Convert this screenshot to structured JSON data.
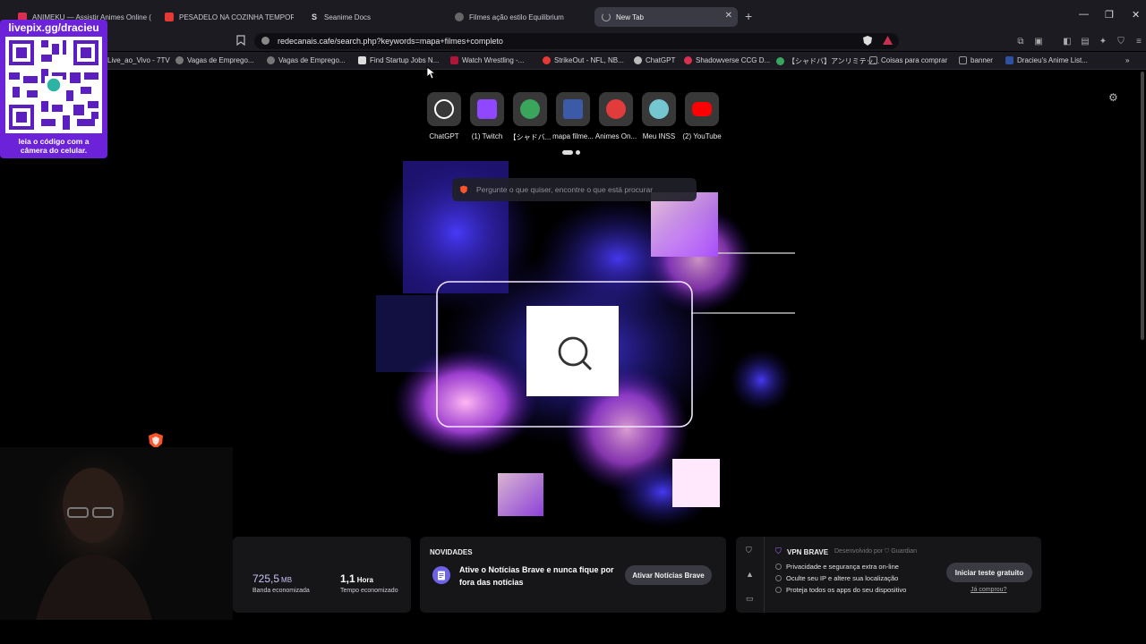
{
  "tabs": [
    {
      "title": "ANIMEKU — Assistir Animes Online (",
      "color": "#d9304f"
    },
    {
      "title": "PESADELO NA COZINHA TEMPORAD",
      "color": "#e53935"
    },
    {
      "title": "Seanime Docs",
      "color": "#222"
    },
    {
      "title": "Filmes ação estilo Equilibrium",
      "color": "#999"
    },
    {
      "title": "New Tab",
      "color": "#888"
    }
  ],
  "address": {
    "url": "redecanais.cafe/search.php?keywords=mapa+filmes+completo"
  },
  "bookmarks": [
    {
      "label": "Live_ao_Vivo - 7TV",
      "color": "#555"
    },
    {
      "label": "Vagas de Emprego...",
      "color": "#777"
    },
    {
      "label": "Vagas de Emprego...",
      "color": "#777"
    },
    {
      "label": "Find Startup Jobs N...",
      "color": "#ddd"
    },
    {
      "label": "Watch Wrestling -...",
      "color": "#b0163a"
    },
    {
      "label": "StrikeOut - NFL, NB...",
      "color": "#e53935"
    },
    {
      "label": "ChatGPT",
      "color": "#bbb"
    },
    {
      "label": "Shadowverse CCG D...",
      "color": "#d9304f"
    },
    {
      "label": "【シャドバ】アンリミテッ...",
      "color": "#3aa55c"
    },
    {
      "label": "Coisas para comprar",
      "color": "#999"
    },
    {
      "label": "banner",
      "color": "#999"
    },
    {
      "label": "Dracieu's Anime List...",
      "color": "#2e51a2"
    }
  ],
  "qr": {
    "title": "livepix.gg/dracieu",
    "caption_line1": "leia o código com a",
    "caption_line2": "câmera do celular."
  },
  "top_sites": [
    {
      "label": "ChatGPT",
      "color": "#ffffff"
    },
    {
      "label": "(1) Twitch",
      "color": "#9146ff"
    },
    {
      "label": "【シャドバ...",
      "color": "#3aa55c"
    },
    {
      "label": "mapa filme...",
      "color": "#3b5ba9"
    },
    {
      "label": "Animes On...",
      "color": "#e23b3b"
    },
    {
      "label": "Meu INSS",
      "color": "#74c7d1"
    },
    {
      "label": "(2) YouTube",
      "color": "#ff0000"
    }
  ],
  "search": {
    "placeholder": "Pergunte o que quiser, encontre o que está procurar"
  },
  "stats": {
    "bandwidth_value": "725,5",
    "bandwidth_unit": "MB",
    "bandwidth_label": "Banda economizada",
    "time_value": "1,1",
    "time_unit": "Hora",
    "time_label": "Tempo economizado"
  },
  "news": {
    "heading": "NOVIDADES",
    "text": "Ative o Notícias Brave e nunca fique por fora das notícias",
    "button": "Ativar Notícias Brave"
  },
  "vpn": {
    "title": "VPN BRAVE",
    "subtitle": "Desenvolvido por",
    "provider": "Guardian",
    "items": [
      "Privacidade e segurança extra on-line",
      "Oculte seu IP e altere sua localização",
      "Proteja todos os apps do seu dispositivo"
    ],
    "button": "Iniciar teste gratuito",
    "link": "Já comprou?"
  },
  "colors": {
    "brave_orange": "#fb542b",
    "accent_purple": "#6b22d8"
  }
}
